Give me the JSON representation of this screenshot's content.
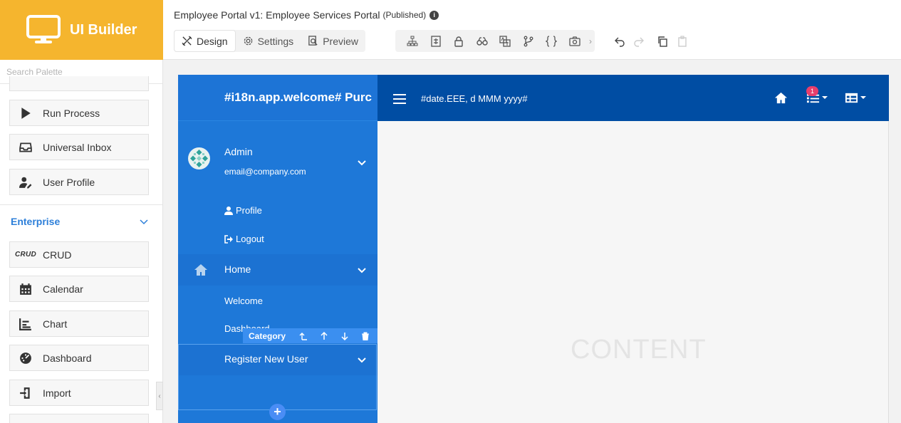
{
  "brand": {
    "title": "UI Builder"
  },
  "palette": {
    "search_placeholder": "Search Palette",
    "items_top": [
      {
        "label": "Run Process",
        "icon": "play-icon"
      },
      {
        "label": "Universal Inbox",
        "icon": "inbox-icon"
      },
      {
        "label": "User Profile",
        "icon": "user-edit-icon"
      }
    ],
    "category": "Enterprise",
    "items_enterprise": [
      {
        "label": "CRUD",
        "icon": "crud-icon",
        "icon_text": "CRUD"
      },
      {
        "label": "Calendar",
        "icon": "calendar-icon"
      },
      {
        "label": "Chart",
        "icon": "chart-icon"
      },
      {
        "label": "Dashboard",
        "icon": "dashboard-icon"
      },
      {
        "label": "Import",
        "icon": "import-icon"
      }
    ]
  },
  "topbar": {
    "title": "Employee Portal v1: Employee Services Portal",
    "status": "(Published)",
    "info": "i",
    "modes": [
      "Design",
      "Settings",
      "Preview"
    ],
    "tool_more": "›"
  },
  "preview": {
    "app_name": "#i18n.app.welcome# Purc",
    "date_format": "#date.EEE, d MMM yyyy#",
    "notification_count": "1",
    "user": {
      "name": "Admin",
      "email": "email@company.com"
    },
    "user_links": [
      "Profile",
      "Logout"
    ],
    "menu_home": "Home",
    "home_items": [
      "Welcome",
      "Dashboard"
    ],
    "category_toolbar": {
      "label": "Category"
    },
    "menu_register": "Register New User",
    "add": "+",
    "content_label": "CONTENT"
  },
  "colors": {
    "brand": "#f5b52e",
    "sidebar": "#1e78d8",
    "header": "#004da3",
    "accent": "#2d7fd9"
  }
}
